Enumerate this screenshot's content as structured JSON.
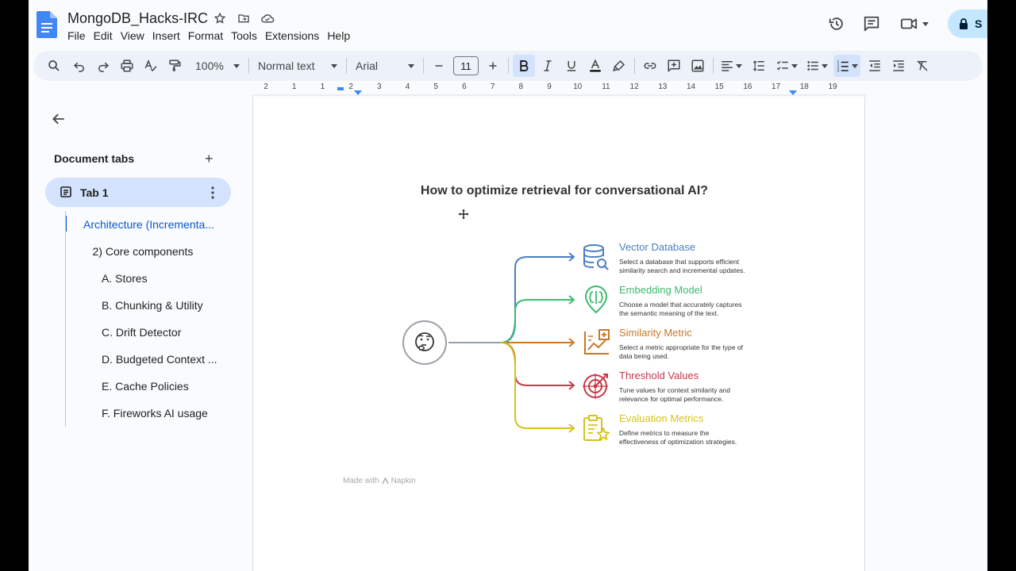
{
  "app": {
    "doc_title": "MongoDB_Hacks-IRC",
    "menu": [
      "File",
      "Edit",
      "View",
      "Insert",
      "Format",
      "Tools",
      "Extensions",
      "Help"
    ],
    "share_label": "S"
  },
  "toolbar": {
    "zoom": "100%",
    "style": "Normal text",
    "font": "Arial",
    "font_size": "11"
  },
  "ruler": {
    "ticks": [
      "2",
      "1",
      "1",
      "2",
      "3",
      "4",
      "5",
      "6",
      "7",
      "8",
      "9",
      "10",
      "11",
      "12",
      "13",
      "14",
      "15",
      "16",
      "17",
      "18",
      "19"
    ]
  },
  "sidebar": {
    "title": "Document tabs",
    "add_label": "+",
    "tab_label": "Tab 1",
    "outline": [
      {
        "label": "Architecture (Incrementa...",
        "indent": 0,
        "active": true
      },
      {
        "label": "2) Core components",
        "indent": 1,
        "active": false
      },
      {
        "label": "A. Stores",
        "indent": 2,
        "active": false
      },
      {
        "label": "B. Chunking & Utility",
        "indent": 2,
        "active": false
      },
      {
        "label": "C. Drift Detector",
        "indent": 2,
        "active": false
      },
      {
        "label": "D. Budgeted Context ...",
        "indent": 2,
        "active": false
      },
      {
        "label": "E. Cache Policies",
        "indent": 2,
        "active": false
      },
      {
        "label": "F. Fireworks AI usage",
        "indent": 2,
        "active": false
      }
    ]
  },
  "document": {
    "heading": "How to optimize retrieval for conversational AI?",
    "diagram": {
      "items": [
        {
          "title": "Vector Database",
          "desc1": "Select a database that supports efficient",
          "desc2": "similarity search and incremental updates.",
          "color": "#4a7fc1",
          "icon": "database-search-icon"
        },
        {
          "title": "Embedding Model",
          "desc1": "Choose a model that accurately captures",
          "desc2": "the semantic meaning of the text.",
          "color": "#3cba6e",
          "icon": "brain-location-icon"
        },
        {
          "title": "Similarity Metric",
          "desc1": "Select a metric appropriate for the type of",
          "desc2": "data being used.",
          "color": "#c7792b",
          "icon": "chart-plus-icon"
        },
        {
          "title": "Threshold Values",
          "desc1": "Tune values for context similarity and",
          "desc2": "relevance for optimal performance.",
          "color": "#c8384a",
          "icon": "target-icon"
        },
        {
          "title": "Evaluation Metrics",
          "desc1": "Define metrics to measure the",
          "desc2": "effectiveness of optimization strategies.",
          "color": "#d7c21b",
          "icon": "clipboard-star-icon"
        }
      ],
      "credit": "Made with",
      "credit_brand": "Napkin"
    }
  }
}
